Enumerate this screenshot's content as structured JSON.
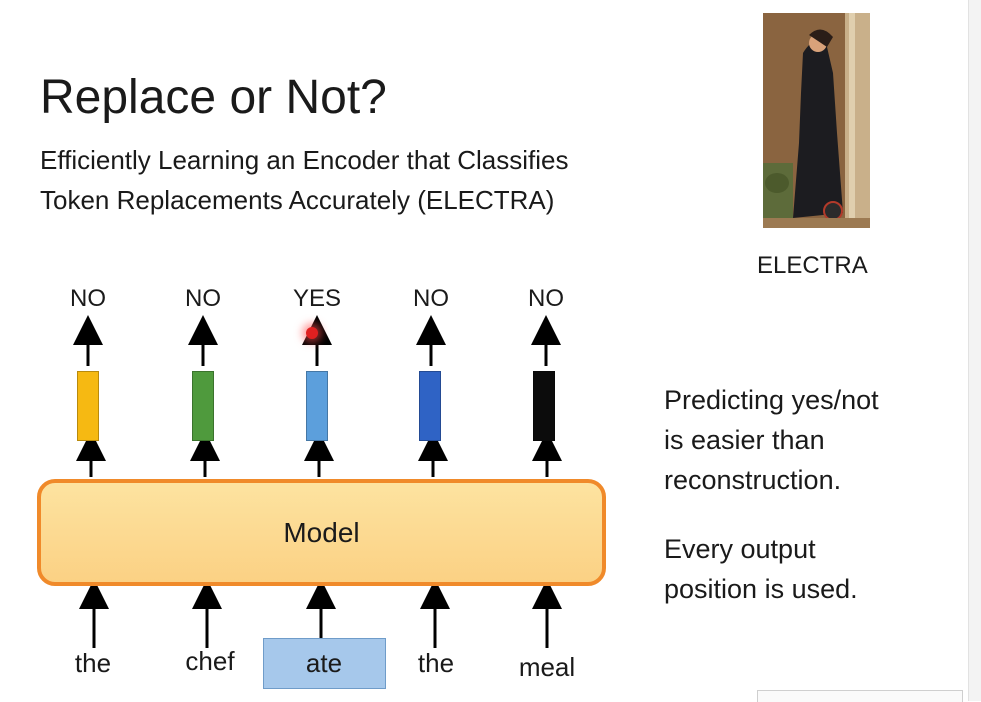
{
  "slide": {
    "title": "Replace or Not?",
    "subtitle_line1": "Efficiently Learning an Encoder that Classifies",
    "subtitle_line2": "Token Replacements Accurately (ELECTRA)",
    "image_caption": "ELECTRA",
    "model_label": "Model",
    "outputs": [
      "NO",
      "NO",
      "YES",
      "NO",
      "NO"
    ],
    "tokens": [
      "the",
      "chef",
      "ate",
      "the",
      "meal"
    ],
    "highlighted_token_index": 2,
    "vector_colors": [
      "#f6b912",
      "#4f9a3d",
      "#5c9fdc",
      "#2f63c5",
      "#0c0c0c"
    ],
    "notes": {
      "note1_line1": "Predicting yes/not",
      "note1_line2": "is easier than",
      "note1_line3": "reconstruction.",
      "note2_line1": "Every output",
      "note2_line2": "position is used."
    }
  }
}
